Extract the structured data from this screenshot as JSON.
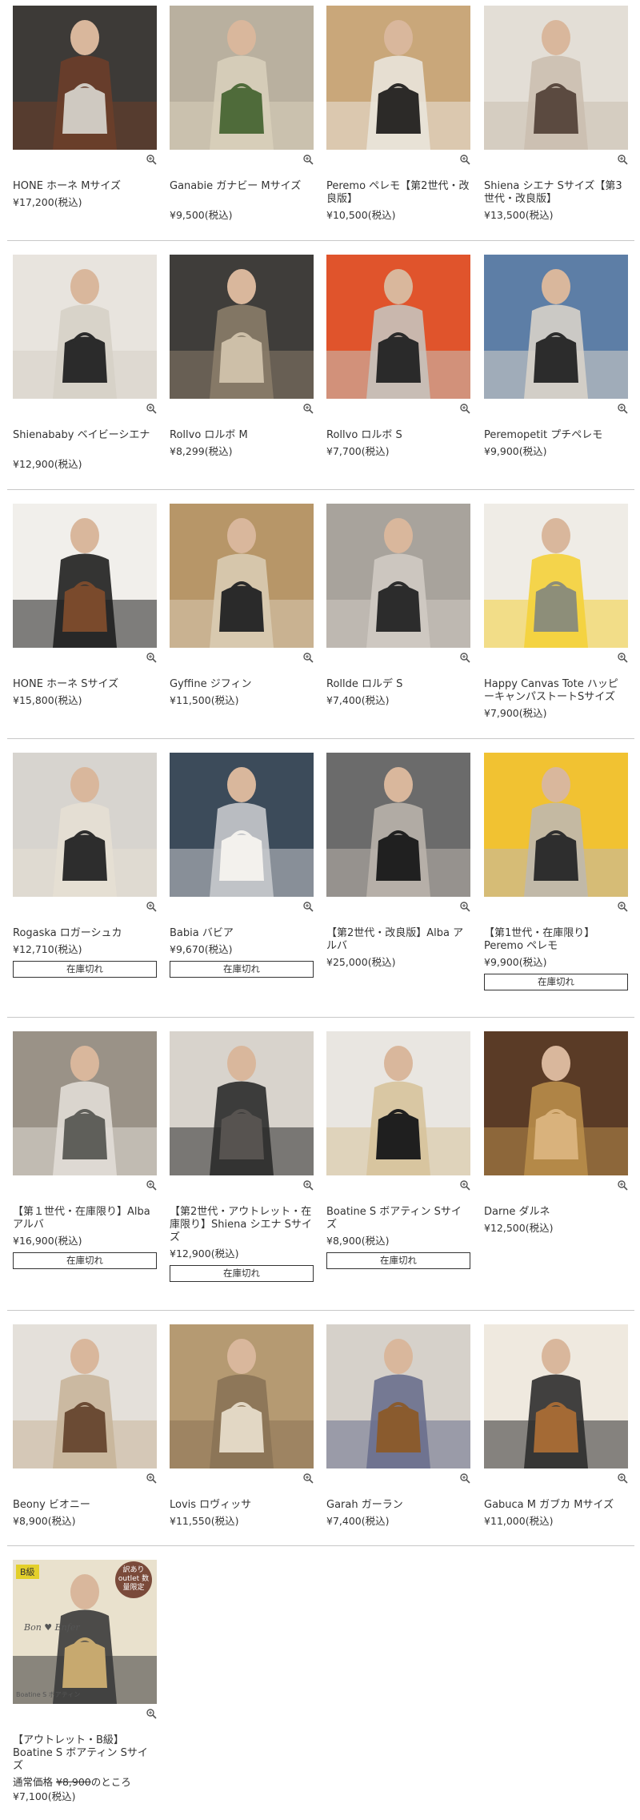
{
  "colors": {
    "text": "#333333",
    "separator": "#c8c8c8",
    "badge_b": "#e3cf2a",
    "badge_outlet": "#7a4a3a"
  },
  "products": [
    {
      "name": "HONE ホーネ Mサイズ",
      "price": "¥17,200(税込)",
      "image": "woman-white-top-brown-handbag"
    },
    {
      "name": "Ganabie ガナビー Mサイズ",
      "price": "¥9,500(税込)",
      "image": "clear-tote-with-plant"
    },
    {
      "name": "Peremo ペレモ【第2世代・改良版】",
      "price": "¥10,500(税込)",
      "image": "woman-trench-coat-quilted-bag"
    },
    {
      "name": "Shiena シエナ Sサイズ【第3世代・改良版】",
      "price": "¥13,500(税込)",
      "image": "woman-glasses-brown-bag"
    },
    {
      "name": "Shienababy ベイビーシエナ",
      "price": "¥12,900(税込)",
      "image": "woman-vest-small-black-bag"
    },
    {
      "name": "Rollvo ロルボ M",
      "price": "¥8,299(税込)",
      "image": "woman-vest-basket-bag"
    },
    {
      "name": "Rollvo ロルボ S",
      "price": "¥7,700(税込)",
      "image": "orange-cardigan-black-basket"
    },
    {
      "name": "Peremopetit プチペレモ",
      "price": "¥9,900(税込)",
      "image": "woman-denim-shirt-quilted-bag"
    },
    {
      "name": "HONE ホーネ Sサイズ",
      "price": "¥15,800(税込)",
      "image": "striped-top-brown-bag"
    },
    {
      "name": "Gyffine ジフィン",
      "price": "¥11,500(税込)",
      "image": "black-pouch-bag"
    },
    {
      "name": "Rollde ロルデ S",
      "price": "¥7,400(税込)",
      "image": "woman-grey-cardigan-black-bag"
    },
    {
      "name": "Happy Canvas Tote ハッピーキャンパストートSサイズ",
      "price": "¥7,900(税込)",
      "image": "canvas-tote-bag"
    },
    {
      "name": "Rogaska ロガーシュカ",
      "price": "¥12,710(税込)",
      "soldout": "在庫切れ",
      "image": "white-bucket-bag-bicycle"
    },
    {
      "name": "Babia バビア",
      "price": "¥9,670(税込)",
      "soldout": "在庫切れ",
      "image": "clear-bag-white-skirt"
    },
    {
      "name": "【第2世代・改良版】Alba アルバ",
      "price": "¥25,000(税込)",
      "image": "black-backpack"
    },
    {
      "name": "【第1世代・在庫限り】Peremo ペレモ",
      "price": "¥9,900(税込)",
      "soldout": "在庫切れ",
      "image": "quilted-bags-yellow-background"
    },
    {
      "name": "【第１世代・在庫限り】Alba アルバ",
      "price": "¥16,900(税込)",
      "soldout": "在庫切れ",
      "image": "grey-backpack"
    },
    {
      "name": "【第2世代・アウトレット・在庫限り】Shiena シエナ Sサイズ",
      "price": "¥12,900(税込)",
      "soldout": "在庫切れ",
      "image": "woman-grey-bag-chair"
    },
    {
      "name": "Boatine S ボアティン Sサイズ",
      "price": "¥8,900(税込)",
      "soldout": "在庫切れ",
      "image": "straw-tote-black-dress"
    },
    {
      "name": "Darne ダルネ",
      "price": "¥12,500(税込)",
      "image": "basket-bag-flowers"
    },
    {
      "name": "Beony ビオニー",
      "price": "¥8,900(税込)",
      "image": "clear-basket-on-chair"
    },
    {
      "name": "Lovis ロヴィッサ",
      "price": "¥11,550(税込)",
      "image": "woven-tote-shoulder"
    },
    {
      "name": "Garah ガーラン",
      "price": "¥7,400(税込)",
      "image": "woman-straw-bag-dried-flowers"
    },
    {
      "name": "Gabuca M ガブカ Mサイズ",
      "price": "¥11,000(税込)",
      "image": "woman-striped-basket-bag"
    },
    {
      "name": "【アウトレット・B級】Boatine S ボアティン Sサイズ",
      "regular_label": "通常価格",
      "regular_price": "¥8,900",
      "regular_suffix": "のところ",
      "price": "¥7,100(税込)",
      "image": "outlet-straw-tote",
      "overlay": {
        "badge_b": "B級",
        "badge_outlet": "訳あり outlet 数量限定",
        "script": "Bon ♥ Enfer",
        "caption": "Boatine S ボアティン"
      }
    }
  ]
}
